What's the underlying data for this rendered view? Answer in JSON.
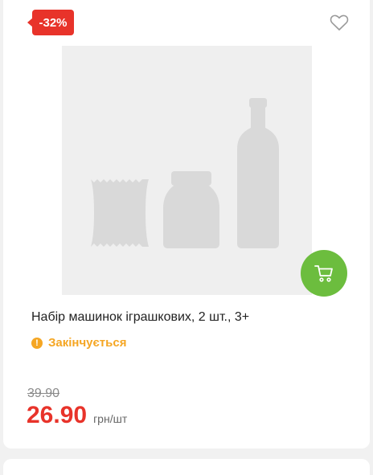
{
  "product": {
    "discount_badge": "-32%",
    "name": "Набір машинок іграшкових, 2 шт., 3+",
    "status": "Закінчується",
    "old_price": "39.90",
    "price": "26.90",
    "unit": "грн/шт"
  },
  "icons": {
    "favorite": "heart-outline-icon",
    "cart": "shopping-cart-icon",
    "placeholder": "product-placeholder-image",
    "status": "warning-icon"
  },
  "colors": {
    "badge": "#e8332a",
    "price": "#e8332a",
    "status": "#f5a623",
    "cart_button": "#6cbd3e"
  }
}
